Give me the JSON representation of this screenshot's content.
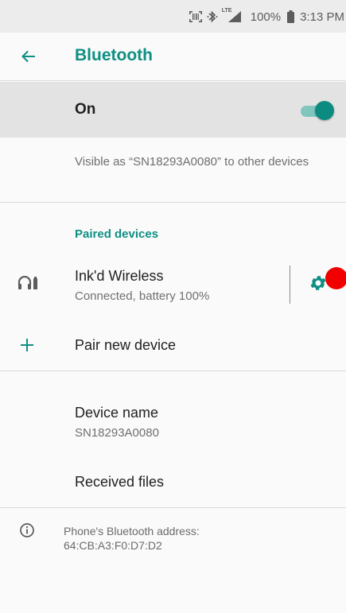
{
  "status_bar": {
    "battery": "100%",
    "time": "3:13 PM",
    "network": "LTE",
    "icons": [
      "barcode-scanner-icon",
      "bluetooth-icon",
      "lte-signal-icon",
      "battery-icon"
    ]
  },
  "app_bar": {
    "title": "Bluetooth",
    "back_icon": "arrow-back-icon"
  },
  "master_switch": {
    "label": "On",
    "state": true
  },
  "visibility_text": "Visible as “SN18293A0080” to other devices",
  "paired_devices": {
    "header": "Paired devices",
    "items": [
      {
        "name": "Ink'd Wireless",
        "status": "Connected, battery 100%",
        "icon": "headset-battery-icon",
        "settings_icon": "gear-icon"
      }
    ]
  },
  "pair_new": {
    "label": "Pair new device",
    "icon": "plus-icon"
  },
  "device_name": {
    "title": "Device name",
    "value": "SN18293A0080"
  },
  "received_files": {
    "title": "Received files"
  },
  "footer": {
    "icon": "info-icon",
    "line1": "Phone's Bluetooth address:",
    "line2": "64:CB:A3:F0:D7:D2"
  },
  "colors": {
    "accent": "#0d8f83",
    "switch_track": "#80c5be",
    "switch_thumb": "#0c8c80",
    "marker": "#f20000",
    "status_bar_bg": "#ececec",
    "master_bg": "#e3e3e3"
  }
}
